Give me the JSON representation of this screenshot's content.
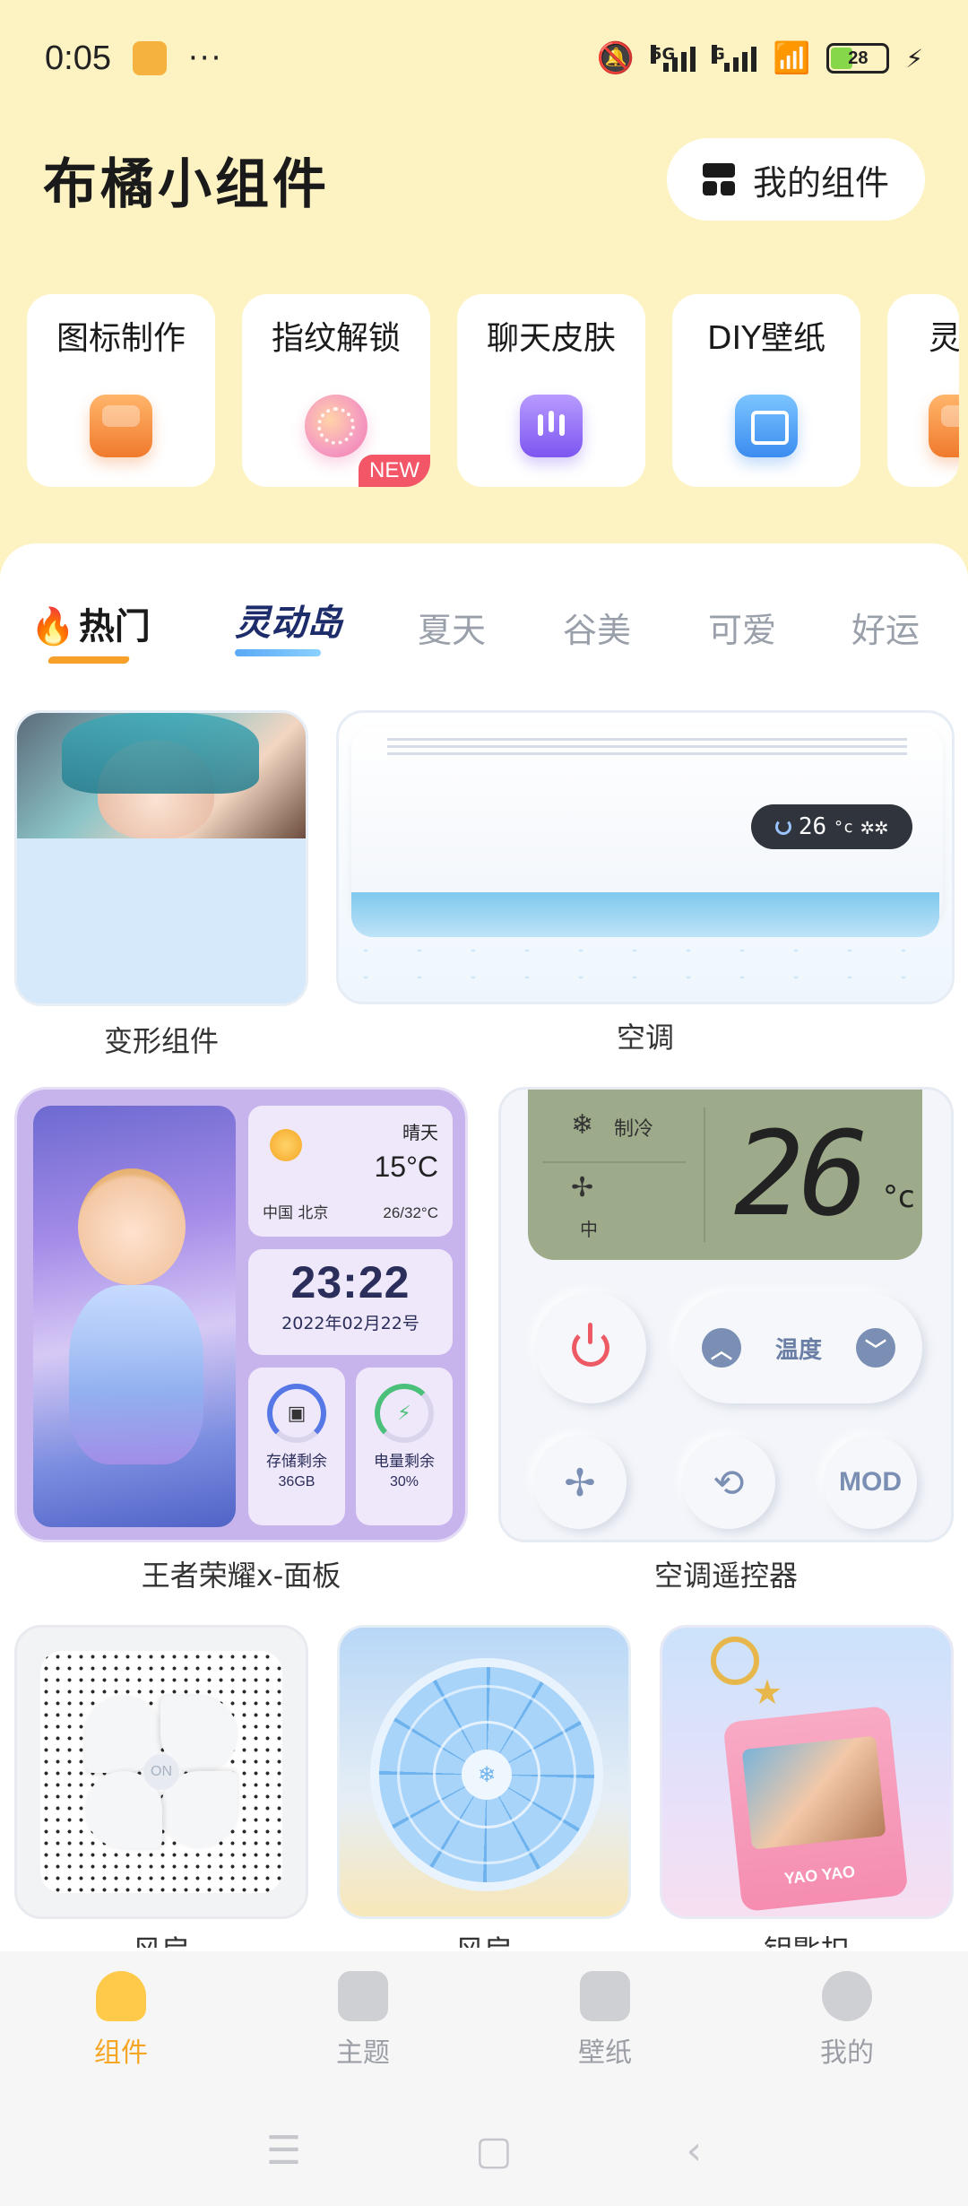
{
  "status_bar": {
    "time": "0:05",
    "dots": "···",
    "net1": "5G",
    "net2": "G",
    "battery": "28"
  },
  "header": {
    "title": "布橘小组件",
    "my_widgets_label": "我的组件"
  },
  "tools": [
    {
      "label": "图标制作",
      "icon": "app-icon-maker"
    },
    {
      "label": "指纹解锁",
      "icon": "fingerprint-icon",
      "badge": "NEW"
    },
    {
      "label": "聊天皮肤",
      "icon": "chat-skin-icon"
    },
    {
      "label": "DIY壁纸",
      "icon": "wallpaper-icon"
    },
    {
      "label": "灵动",
      "icon": "island-icon"
    }
  ],
  "tabs": [
    {
      "label": "热门",
      "icon": "flame-icon",
      "active": true
    },
    {
      "label": "灵动岛"
    },
    {
      "label": "夏天"
    },
    {
      "label": "谷美"
    },
    {
      "label": "可爱"
    },
    {
      "label": "好运"
    }
  ],
  "widgets": {
    "deform": {
      "label": "变形组件"
    },
    "ac": {
      "label": "空调",
      "display_temp": "26",
      "display_unit": "°c",
      "display_icons": "✲✲"
    },
    "king_panel": {
      "label": "王者荣耀x-面板",
      "weather": "晴天",
      "temp": "15°C",
      "location": "中国 北京",
      "range": "26/32°C",
      "time": "23:22",
      "date": "2022年02月22号",
      "storage_label": "存储剩余",
      "storage_value": "36GB",
      "battery_label": "电量剩余",
      "battery_value": "30%"
    },
    "remote": {
      "label": "空调遥控器",
      "mode": "制冷",
      "speed": "中",
      "temp": "26",
      "unit": "°c",
      "temp_control_label": "温度",
      "mod_label": "MOD"
    },
    "fan1": {
      "label": "风扇",
      "on_label": "ON"
    },
    "fan2": {
      "label": "风扇"
    },
    "keychain": {
      "label": "钥匙扣",
      "name_tag": "YAO YAO"
    }
  },
  "bottom_nav": [
    {
      "label": "组件",
      "icon": "home-icon",
      "active": true
    },
    {
      "label": "主题",
      "icon": "theme-icon"
    },
    {
      "label": "壁纸",
      "icon": "image-icon"
    },
    {
      "label": "我的",
      "icon": "smile-icon"
    }
  ],
  "colors": {
    "background": "#fdf3c2",
    "accent": "#f6a623",
    "badge": "#f25667"
  }
}
